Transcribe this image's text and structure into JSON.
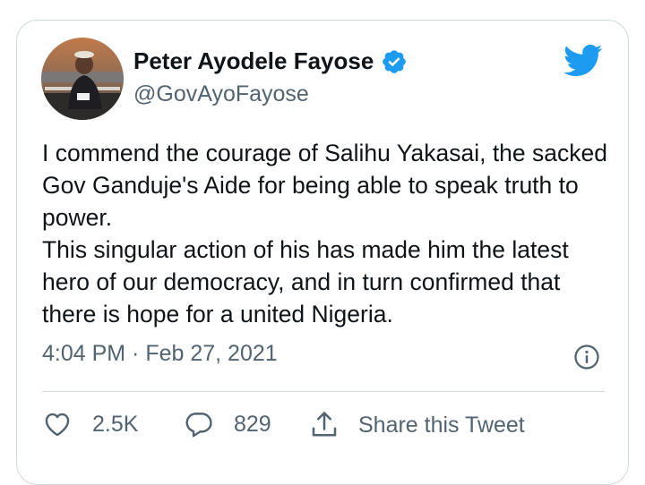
{
  "tweet": {
    "display_name": "Peter Ayodele Fayose",
    "handle": "@GovAyoFayose",
    "text": "I commend the courage of Salihu Yakasai, the sacked Gov Ganduje's Aide for being able to speak truth to power.\nThis singular action of his has made him the latest hero of our democracy, and in turn confirmed that there is hope for a united Nigeria.",
    "timestamp": "4:04 PM · Feb 27, 2021",
    "verified": true
  },
  "actions": {
    "likes": "2.5K",
    "replies": "829",
    "share_label": "Share this Tweet"
  },
  "icons": {
    "brand": "twitter-bird-icon",
    "verified": "verified-badge-icon",
    "info": "info-icon",
    "like": "heart-icon",
    "reply": "reply-bubble-icon",
    "share": "share-icon"
  },
  "colors": {
    "brand_blue": "#1d9bf0",
    "text": "#0f1419",
    "secondary_text": "#536471",
    "border": "#cfd9de"
  }
}
